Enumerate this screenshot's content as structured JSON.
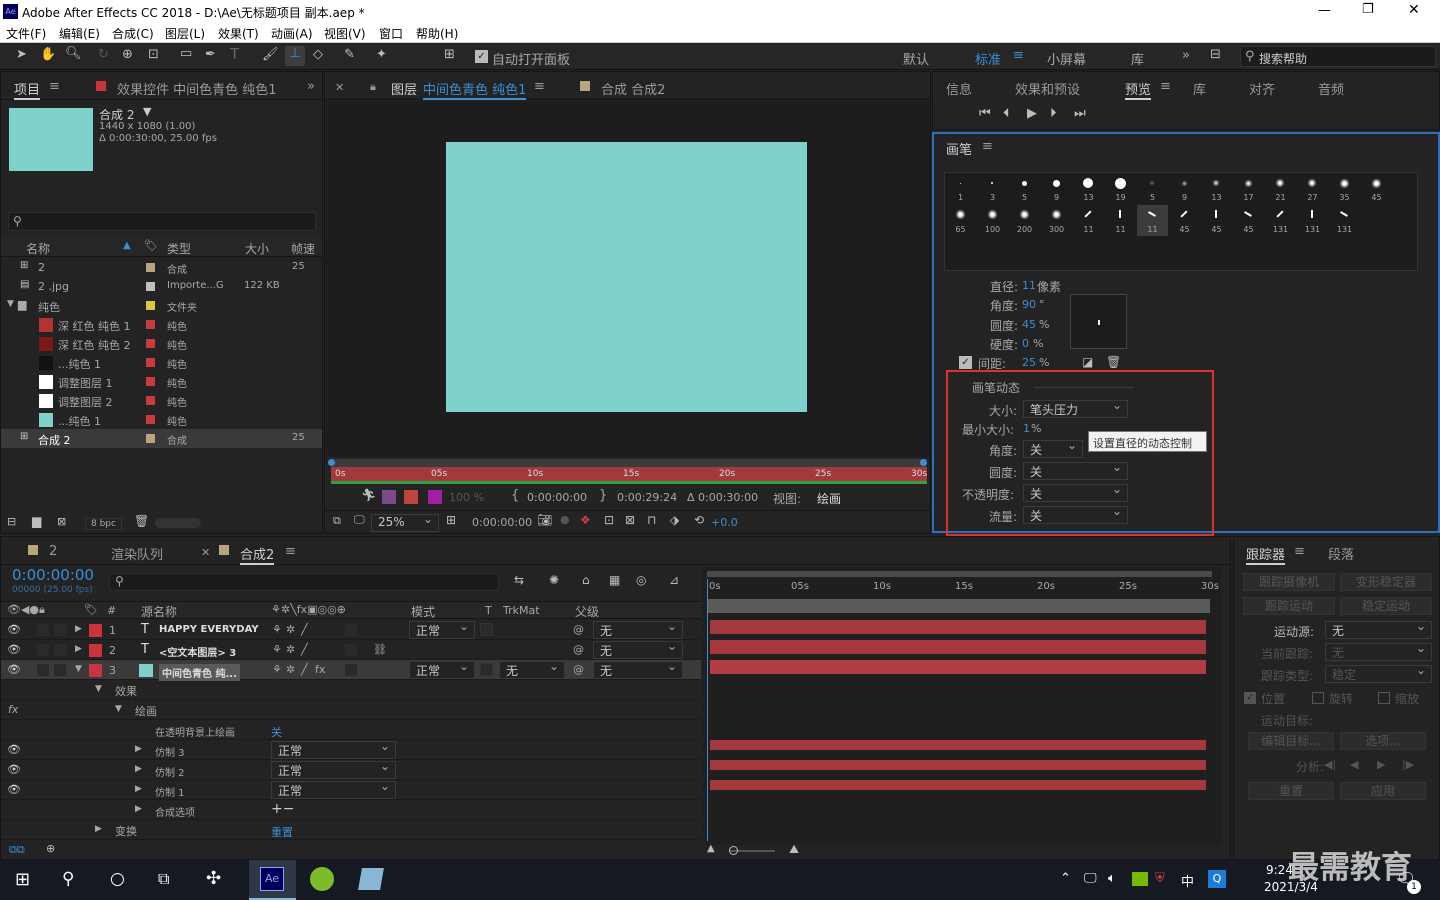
{
  "app": {
    "title": "Adobe After Effects CC 2018 - D:\\Ae\\无标题项目 副本.aep *",
    "logo": "Ae",
    "min": "—",
    "max": "❐",
    "close": "✕"
  },
  "menu": [
    "文件(F)",
    "编辑(E)",
    "合成(C)",
    "图层(L)",
    "效果(T)",
    "动画(A)",
    "视图(V)",
    "窗口",
    "帮助(H)"
  ],
  "toolbar": {
    "auto_open": "自动打开面板",
    "workspaces": [
      "默认",
      "标准",
      "小屏幕",
      "库"
    ],
    "search": "搜索帮助"
  },
  "project": {
    "tab": "项目",
    "effects_tab": "效果控件 中间色青色 纯色1",
    "comp_name": "合成 2",
    "comp_res": "1440 x 1080 (1.00)",
    "comp_dur": "Δ 0:00:30:00, 25.00 fps",
    "cols": [
      "名称",
      "类型",
      "大小",
      "帧速"
    ],
    "items": [
      {
        "name": "2",
        "type": "合成",
        "size": "",
        "fps": "25",
        "color": "#b9a47b",
        "sw": ""
      },
      {
        "name": "2 .jpg",
        "type": "Importe...G",
        "size": "122 KB",
        "fps": "",
        "color": "#bfbfbf",
        "sw": ""
      },
      {
        "name": "纯色",
        "type": "文件夹",
        "size": "",
        "fps": "",
        "color": "#d8c93b",
        "sw": ""
      },
      {
        "name": "深 红色 纯色 1",
        "type": "纯色",
        "size": "",
        "fps": "",
        "color": "#c93b3b",
        "sw": "#b33232"
      },
      {
        "name": "深 红色 纯色 2",
        "type": "纯色",
        "size": "",
        "fps": "",
        "color": "#c93b3b",
        "sw": "#7a1a1a"
      },
      {
        "name": "...纯色 1",
        "type": "纯色",
        "size": "",
        "fps": "",
        "color": "#c93b3b",
        "sw": "#111111"
      },
      {
        "name": "调整图层 1",
        "type": "纯色",
        "size": "",
        "fps": "",
        "color": "#c93b3b",
        "sw": "#ffffff"
      },
      {
        "name": "调整图层 2",
        "type": "纯色",
        "size": "",
        "fps": "",
        "color": "#c93b3b",
        "sw": "#ffffff"
      },
      {
        "name": "...纯色 1",
        "type": "纯色",
        "size": "",
        "fps": "",
        "color": "#c93b3b",
        "sw": "#7fd1cb"
      },
      {
        "name": "合成 2",
        "type": "合成",
        "size": "",
        "fps": "25",
        "color": "#b9a47b",
        "sw": ""
      }
    ],
    "bpc": "8 bpc"
  },
  "viewer": {
    "tab_layer": "图层",
    "layer_name": "中间色青色 纯色1",
    "tab_comp": "合成 合成2",
    "ruler": [
      "0s",
      "05s",
      "10s",
      "15s",
      "20s",
      "25s",
      "30s"
    ],
    "opacity": "100 %",
    "t_in": "0:00:00:00",
    "t_out": "0:00:29:24",
    "t_dur": "Δ 0:00:30:00",
    "view_label": "视图:",
    "view_val": "绘画",
    "zoom": "25%",
    "time": "0:00:00:00",
    "offset": "+0.0"
  },
  "info_tabs": [
    "信息",
    "效果和预设",
    "预览",
    "库",
    "对齐",
    "音频"
  ],
  "brush": {
    "title": "画笔",
    "row1": [
      "1",
      "3",
      "5",
      "9",
      "13",
      "19",
      "5",
      "9",
      "13",
      "17",
      "21",
      "27",
      "35",
      "45"
    ],
    "row2": [
      "65",
      "100",
      "200",
      "300",
      "11",
      "11",
      "11",
      "45",
      "45",
      "45",
      "131",
      "131",
      "131"
    ],
    "diameter_l": "直径:",
    "diameter_v": "11",
    "diameter_u": "像素",
    "angle_l": "角度:",
    "angle_v": "90",
    "angle_u": "°",
    "round_l": "圆度:",
    "round_v": "45",
    "round_u": "%",
    "hard_l": "硬度:",
    "hard_v": "0",
    "hard_u": "%",
    "space_l": "间距:",
    "space_v": "25",
    "space_u": "%",
    "dyn_title": "画笔动态",
    "size_l": "大小:",
    "size_v": "笔头压力",
    "min_l": "最小大小:",
    "min_v": "1",
    "min_u": "%",
    "tooltip": "设置直径的动态控制",
    "dangle_l": "角度:",
    "dangle_v": "关",
    "dround_l": "圆度:",
    "dround_v": "关",
    "opac_l": "不透明度:",
    "opac_v": "关",
    "flow_l": "流量:",
    "flow_v": "关"
  },
  "timeline": {
    "tab1": "2",
    "tab2": "渲染队列",
    "tab3": "合成2",
    "time": "0:00:00:00",
    "fps": "00000 (25.00 fps)",
    "cols": {
      "name": "源名称",
      "mode": "模式",
      "t": "T",
      "trk": "TrkMat",
      "parent": "父级"
    },
    "layers": [
      {
        "num": "1",
        "name": "HAPPY EVERYDAY",
        "mode": "正常",
        "trk": "",
        "parent": "无",
        "icon": "T"
      },
      {
        "num": "2",
        "name": "<空文本图层> 3",
        "mode": "",
        "trk": "",
        "parent": "无",
        "icon": "T"
      },
      {
        "num": "3",
        "name": "中间色青色 纯...",
        "mode": "正常",
        "trk": "无",
        "parent": "无",
        "icon": ""
      }
    ],
    "effects": "效果",
    "paint": "绘画",
    "paint_on": "在透明背景上绘画",
    "paint_on_v": "关",
    "clones": [
      {
        "name": "仿制 3",
        "mode": "正常"
      },
      {
        "name": "仿制 2",
        "mode": "正常"
      },
      {
        "name": "仿制 1",
        "mode": "正常"
      }
    ],
    "composite": "合成选项",
    "transform": "变换",
    "reset": "重置",
    "ruler": [
      "0s",
      "05s",
      "10s",
      "15s",
      "20s",
      "25s",
      "30s"
    ]
  },
  "tracker": {
    "tab": "跟踪器",
    "tab2": "段落",
    "b1": "跟踪摄像机",
    "b2": "变形稳定器",
    "b3": "跟踪运动",
    "b4": "稳定运动",
    "src_l": "运动源:",
    "src_v": "无",
    "cur_l": "当前跟踪:",
    "cur_v": "无",
    "type_l": "跟踪类型:",
    "type_v": "稳定",
    "pos": "位置",
    "rot": "旋转",
    "scale": "缩放",
    "target": "运动目标:",
    "edit": "编辑目标...",
    "opts": "选项...",
    "analyze": "分析:",
    "reset": "重置",
    "apply": "应用"
  },
  "taskbar": {
    "time": "9:24",
    "date": "2021/3/4",
    "ime": "中",
    "watermark": "最需教育",
    "badge": "1"
  }
}
